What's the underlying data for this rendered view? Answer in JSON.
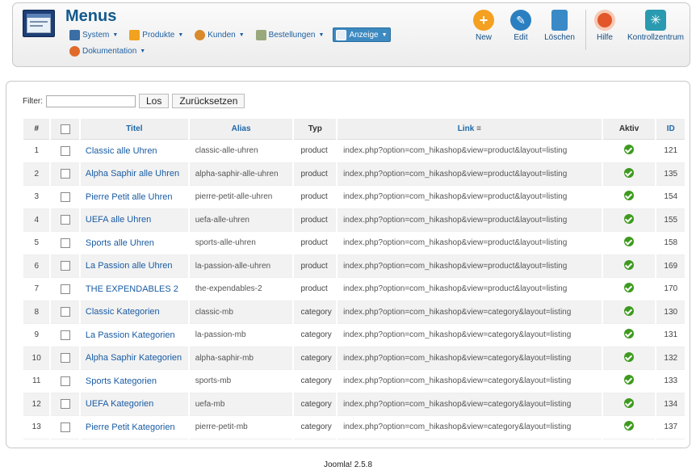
{
  "header": {
    "title": "Menus",
    "menu": [
      {
        "label": "System",
        "icon": "tools-icon",
        "color": "#3a6ea5"
      },
      {
        "label": "Produkte",
        "icon": "box-icon",
        "color": "#f2a21e"
      },
      {
        "label": "Kunden",
        "icon": "users-icon",
        "color": "#d88a2c"
      },
      {
        "label": "Bestellungen",
        "icon": "orders-icon",
        "color": "#9aa87e"
      },
      {
        "label": "Anzeige",
        "icon": "display-icon",
        "color": "#4f8fc6"
      },
      {
        "label": "Dokumentation",
        "icon": "lifebuoy-icon",
        "color": "#e06a2a"
      }
    ],
    "toolbar": [
      {
        "label": "New",
        "icon": "plus-icon",
        "color": "#f4a020"
      },
      {
        "label": "Edit",
        "icon": "pencil-icon",
        "color": "#2a7fc0"
      },
      {
        "label": "Löschen",
        "icon": "trash-icon",
        "color": "#3a8ac8"
      },
      {
        "label": "Hilfe",
        "icon": "lifebuoy-icon",
        "color": "#e2562a"
      },
      {
        "label": "Kontrollzentrum",
        "icon": "control-center-icon",
        "color": "#2a9ab0"
      }
    ]
  },
  "filter": {
    "label": "Filter:",
    "value": "",
    "go": "Los",
    "reset": "Zurücksetzen"
  },
  "table": {
    "columns": [
      "#",
      "",
      "Titel",
      "Alias",
      "Typ",
      "Link",
      "Aktiv",
      "ID"
    ],
    "rows": [
      {
        "n": "1",
        "title": "Classic alle Uhren",
        "alias": "classic-alle-uhren",
        "type": "product",
        "link": "index.php?option=com_hikashop&view=product&layout=listing",
        "id": "121"
      },
      {
        "n": "2",
        "title": "Alpha Saphir alle Uhren",
        "alias": "alpha-saphir-alle-uhren",
        "type": "product",
        "link": "index.php?option=com_hikashop&view=product&layout=listing",
        "id": "135"
      },
      {
        "n": "3",
        "title": "Pierre Petit alle Uhren",
        "alias": "pierre-petit-alle-uhren",
        "type": "product",
        "link": "index.php?option=com_hikashop&view=product&layout=listing",
        "id": "154"
      },
      {
        "n": "4",
        "title": "UEFA alle Uhren",
        "alias": "uefa-alle-uhren",
        "type": "product",
        "link": "index.php?option=com_hikashop&view=product&layout=listing",
        "id": "155"
      },
      {
        "n": "5",
        "title": "Sports alle Uhren",
        "alias": "sports-alle-uhren",
        "type": "product",
        "link": "index.php?option=com_hikashop&view=product&layout=listing",
        "id": "158"
      },
      {
        "n": "6",
        "title": "La Passion alle Uhren",
        "alias": "la-passion-alle-uhren",
        "type": "product",
        "link": "index.php?option=com_hikashop&view=product&layout=listing",
        "id": "169"
      },
      {
        "n": "7",
        "title": "THE EXPENDABLES 2",
        "alias": "the-expendables-2",
        "type": "product",
        "link": "index.php?option=com_hikashop&view=product&layout=listing",
        "id": "170"
      },
      {
        "n": "8",
        "title": "Classic Kategorien",
        "alias": "classic-mb",
        "type": "category",
        "link": "index.php?option=com_hikashop&view=category&layout=listing",
        "id": "130"
      },
      {
        "n": "9",
        "title": "La Passion Kategorien",
        "alias": "la-passion-mb",
        "type": "category",
        "link": "index.php?option=com_hikashop&view=category&layout=listing",
        "id": "131"
      },
      {
        "n": "10",
        "title": "Alpha Saphir Kategorien",
        "alias": "alpha-saphir-mb",
        "type": "category",
        "link": "index.php?option=com_hikashop&view=category&layout=listing",
        "id": "132"
      },
      {
        "n": "11",
        "title": "Sports Kategorien",
        "alias": "sports-mb",
        "type": "category",
        "link": "index.php?option=com_hikashop&view=category&layout=listing",
        "id": "133"
      },
      {
        "n": "12",
        "title": "UEFA Kategorien",
        "alias": "uefa-mb",
        "type": "category",
        "link": "index.php?option=com_hikashop&view=category&layout=listing",
        "id": "134"
      },
      {
        "n": "13",
        "title": "Pierre Petit Kategorien",
        "alias": "pierre-petit-mb",
        "type": "category",
        "link": "index.php?option=com_hikashop&view=category&layout=listing",
        "id": "137"
      }
    ]
  },
  "footer": {
    "text": "Joomla! 2.5.8"
  },
  "colors": {
    "accent": "#125a8c",
    "active_menu": "#3d8ac1",
    "status_ok": "#3d9a1e"
  }
}
